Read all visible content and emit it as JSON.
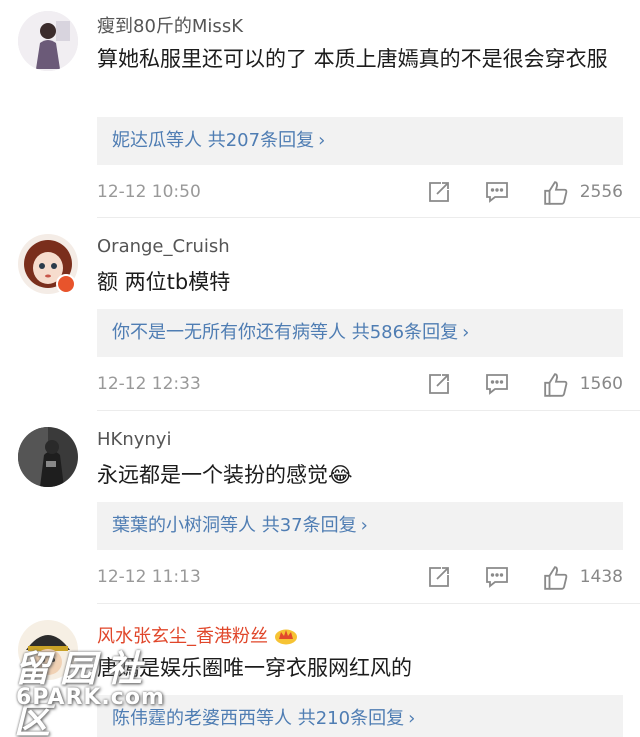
{
  "comments": [
    {
      "username": "瘦到80斤的MissK",
      "text": "算她私服里还可以的了 本质上唐嫣真的不是很会穿衣服",
      "replies": {
        "who": "妮达瓜",
        "suffix": "等人 共207条回复",
        "chevron": "›"
      },
      "time": "12-12 10:50",
      "likes": "2556",
      "avatar": "avatar-girl-light"
    },
    {
      "username": "Orange_Cruish",
      "text": "额 两位tb模特",
      "replies": {
        "who": "你不是一无所有你还有病",
        "suffix": "等人 共586条回复",
        "chevron": "›"
      },
      "time": "12-12 12:33",
      "likes": "1560",
      "avatar": "avatar-doll"
    },
    {
      "username": "HKnynyi",
      "text": "永远都是一个装扮的感觉😂",
      "replies": {
        "who": "葉葉的小树洞",
        "suffix": "等人 共37条回复",
        "chevron": "›"
      },
      "time": "12-12 11:13",
      "likes": "1438",
      "avatar": "avatar-dark-photo"
    },
    {
      "username": "风水张玄尘_香港粉丝",
      "text": "唐嫣是娱乐圈唯一穿衣服网红风的",
      "replies": {
        "who": "陈伟霆的老婆西西",
        "suffix": "等人 共210条回复",
        "chevron": "›"
      },
      "avatar": "avatar-cartoon-hat",
      "vip": true
    }
  ],
  "watermark": {
    "cn": "留园社区",
    "en": "6PARK.com"
  },
  "icons": {
    "repost": "repost-icon",
    "comment": "comment-icon",
    "like": "thumbs-up-icon",
    "vip": "crown-icon"
  },
  "colors": {
    "link": "#4f7db3",
    "vip_name": "#e0462a",
    "reply_bg": "#f2f2f2",
    "muted": "#999999"
  }
}
